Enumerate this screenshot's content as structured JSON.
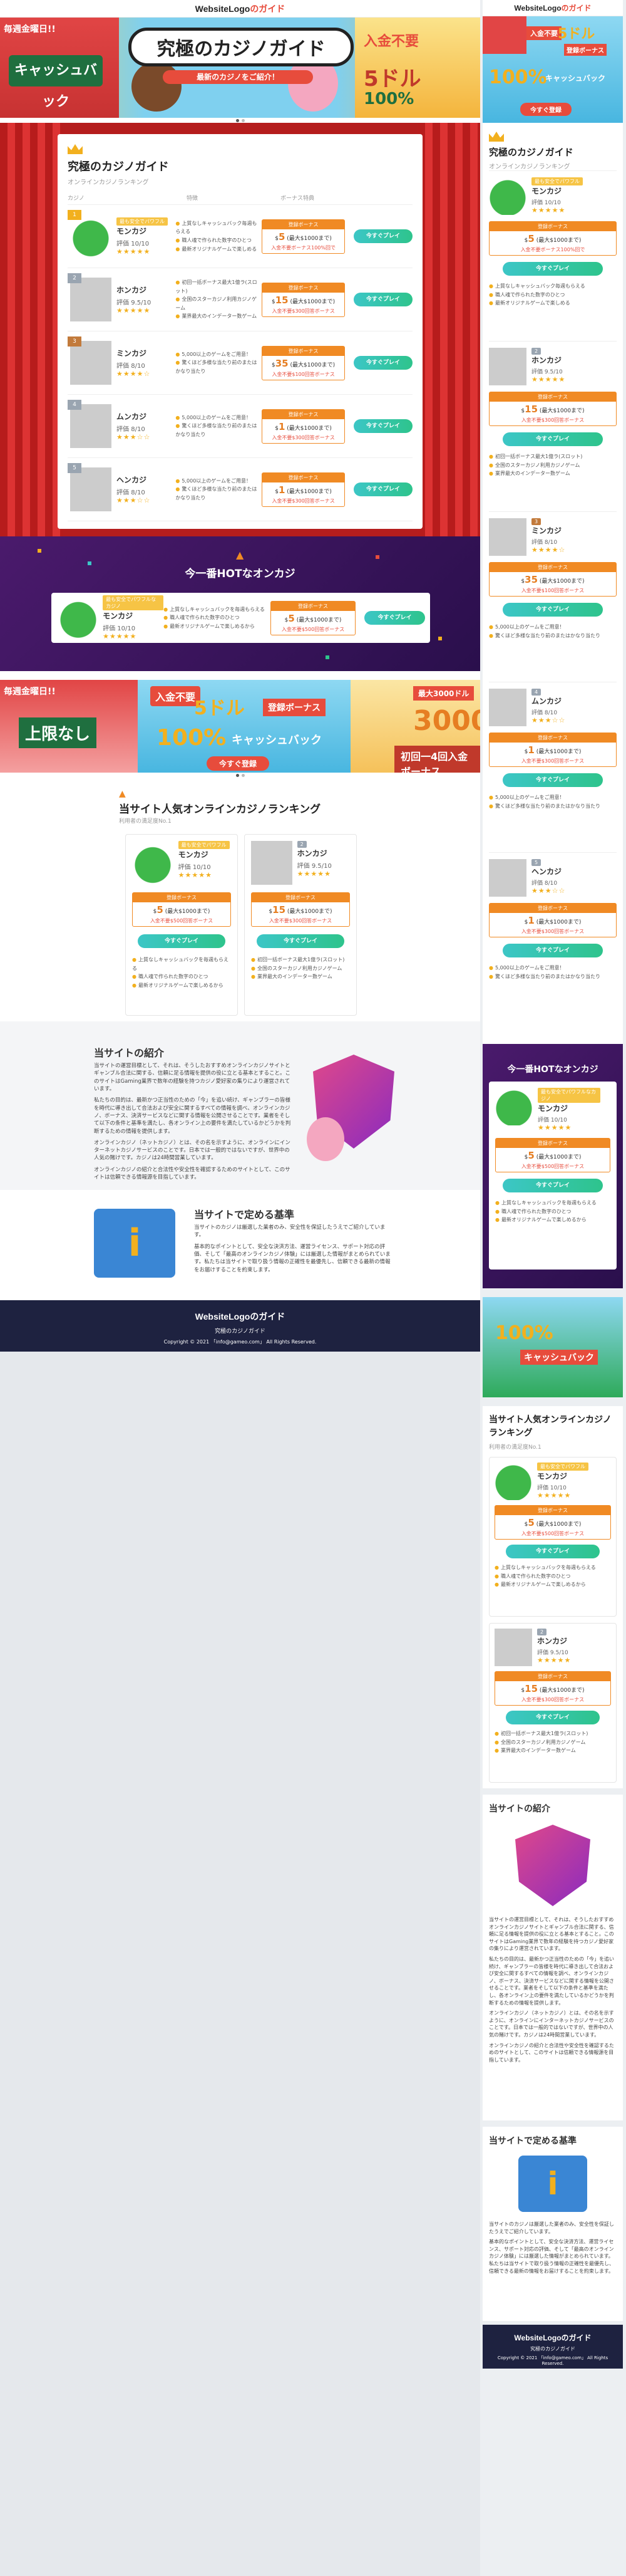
{
  "site": {
    "logo_main": "WebsiteLogo",
    "logo_accent": "のガイド"
  },
  "banner1": {
    "title": "究極のカジノガイド",
    "subtitle": "最新のカジノをご紹介！",
    "left_top": "毎週金曜日!!",
    "left_mid": "キャッシュバック",
    "right_top": "入金不要",
    "right_mid": "5ドル",
    "right_bottom": "100%"
  },
  "ranking": {
    "title": "究極のカジノガイド",
    "subtitle": "オンラインカジノランキング",
    "col1": "カジノ",
    "col2": "特徴",
    "col3": "ボーナス特典",
    "play": "今すぐプレイ",
    "rows": [
      {
        "rank": "1",
        "tag": "最も安全でパワフル",
        "name": "モンカジ",
        "score_label": "評価",
        "score": "10/10",
        "stars": "★★★★★",
        "f1": "上質なしキャッシュバック毎週もらえる",
        "f2": "職人魂で作られた数字のひとつ",
        "f3": "最新オリジナルゲームで楽しめる",
        "bonus_head": "登録ボーナス",
        "bonus_val": "$",
        "bonus_num": "5",
        "bonus_unit": "(最大$1000まで)",
        "bonus_note": "入金不要ボーナス100%回で",
        "bonus_note2": "入金不要$500回答ボーナス"
      },
      {
        "rank": "2",
        "tag": "",
        "name": "ホンカジ",
        "score_label": "評価",
        "score": "9.5/10",
        "stars": "★★★★★",
        "f1": "初回一括ボーナス最大1億ラ(スロット)",
        "f2": "全国のスターカジノ利用カジノゲーム",
        "f3": "業界最大のインデーター数ゲーム",
        "bonus_head": "登録ボーナス",
        "bonus_val": "$",
        "bonus_num": "15",
        "bonus_unit": "(最大$1000まで)",
        "bonus_note": "入金不要$300回答ボーナス",
        "bonus_note2": ""
      },
      {
        "rank": "3",
        "tag": "",
        "name": "ミンカジ",
        "score_label": "評価",
        "score": "8/10",
        "stars": "★★★★☆",
        "f1": "5,000以上のゲームをご用意！",
        "f2": "驚くほど多様な当たり前のまたはかなり当たり",
        "f3": "",
        "bonus_head": "登録ボーナス",
        "bonus_val": "$",
        "bonus_num": "35",
        "bonus_unit": "(最大$1000まで)",
        "bonus_note": "入金不要$100回答ボーナス",
        "bonus_note2": ""
      },
      {
        "rank": "4",
        "tag": "",
        "name": "ムンカジ",
        "score_label": "評価",
        "score": "8/10",
        "stars": "★★★☆☆",
        "f1": "5,000以上のゲームをご用意！",
        "f2": "驚くほど多様な当たり前のまたはかなり当たり",
        "f3": "",
        "bonus_head": "登録ボーナス",
        "bonus_val": "$",
        "bonus_num": "1",
        "bonus_unit": "(最大$1000まで)",
        "bonus_note": "入金不要$300回答ボーナス",
        "bonus_note2": ""
      },
      {
        "rank": "5",
        "tag": "",
        "name": "ヘンカジ",
        "score_label": "評価",
        "score": "8/10",
        "stars": "★★★☆☆",
        "f1": "5,000以上のゲームをご用意！",
        "f2": "驚くほど多様な当たり前のまたはかなり当たり",
        "f3": "",
        "bonus_head": "登録ボーナス",
        "bonus_val": "$",
        "bonus_num": "1",
        "bonus_unit": "(最大$1000まで)",
        "bonus_note": "入金不要$300回答ボーナス",
        "bonus_note2": ""
      }
    ]
  },
  "hot": {
    "title": "今一番HOTなオンカジ",
    "tag": "最も安全でパワフルなカジノ",
    "name": "モンカジ",
    "score_label": "評価",
    "score": "10/10",
    "stars": "★★★★★",
    "f1": "上質なしキャッシュバックを毎週もらえる",
    "f2": "職人魂で作られた数字のひとつ",
    "f3": "最新オリジナルゲームで楽しめるから",
    "bonus_head": "登録ボーナス",
    "bonus_num": "5",
    "bonus_unit": "(最大$1000まで)",
    "bonus_note": "入金不要$500回答ボーナス",
    "play": "今すぐプレイ"
  },
  "banner2": {
    "left_top": "毎週金曜日!!",
    "left_mid": "上限なし",
    "mid_top": "入金不要",
    "mid_big": "5ドル",
    "mid_bonus": "登録ボーナス",
    "mid_pct": "100%",
    "mid_cb": "キャッシュバック",
    "mid_btn": "今すぐ登録",
    "right_top": "最大3000ドル",
    "right_big": "3000",
    "right_sub": "初回一4回入金ボーナス"
  },
  "rank2": {
    "title": "当サイト人気オンラインカジノランキング",
    "subtitle": "利用者の満足度No.1",
    "play": "今すぐプレイ",
    "cards": [
      {
        "rank": "1",
        "tag": "最も安全でパワフル",
        "name": "モンカジ",
        "score_label": "評価",
        "score": "10/10",
        "stars": "★★★★★",
        "bonus_head": "登録ボーナス",
        "bonus_num": "5",
        "bonus_unit": "(最大$1000まで)",
        "bonus_note": "入金不要$500回答ボーナス",
        "f1": "上質なしキャッシュバックを毎週もらえる",
        "f2": "職人魂で作られた数字のひとつ",
        "f3": "最新オリジナルゲームで楽しめるから"
      },
      {
        "rank": "2",
        "tag": "",
        "name": "ホンカジ",
        "score_label": "評価",
        "score": "9.5/10",
        "stars": "★★★★★",
        "bonus_head": "登録ボーナス",
        "bonus_num": "15",
        "bonus_unit": "(最大$1000まで)",
        "bonus_note": "入金不要$300回答ボーナス",
        "f1": "初回一括ボーナス最大1億ラ(スロット)",
        "f2": "全国のスターカジノ利用カジノゲーム",
        "f3": "業界最大のインデーター数ゲーム"
      }
    ]
  },
  "intro": {
    "title": "当サイトの紹介",
    "p1": "当サイトの運営目標として、それは、そうしたおすすめオンラインカジノサイトとギャンブル合法に関する、信頼に足る情報を提供の役に立とる基本とすること。このサイトはGaming業界で数年の経験を持つカジノ愛好家の集りにより運営されています。",
    "p2": "私たちの目的は、最新かつ正当性のための「今」を追い続け、ギャンブラーの皆様を時代に導き出して合法および安全に関するすべての情報を調べ、オンラインカジノ、ボーナス、決済サービスなどに関する情報を公開させることです。業者をそして以下の条件と基準を満たし、各オンライン上の要件を満たしているかどうかを判断するための情報を提供します。",
    "p3": "オンラインカジノ（ネットカジノ）とは、その名を示すように、オンラインにインターネットカジノサービスのことです。日本では一般的ではないですが、世界中の人気の賭けです。カジノは24時間営業しています。",
    "p4": "オンラインカジノの紹介と合法性や安全性を確認するためのサイトとして、このサイトは信頼できる情報源を目指しています。"
  },
  "standard": {
    "title": "当サイトで定める基準",
    "p1": "当サイトのカジノは厳選した業者のみ、安全性を保証したうえでご紹介しています。",
    "p2": "基本的なポイントとして、安全な決済方法、運営ライセンス、サポート対応の評価、そして「最高のオンラインカジノ体験」には厳選した情報がまとめられています。私たちは当サイトで取り扱う情報の正確性を最優先し、信頼できる最新の情報をお届けすることを約束します。"
  },
  "footer": {
    "sub": "究極のカジノガイド",
    "copy": "Copyright © 2021 「info@gameo.com」 All Rights Reserved."
  },
  "right_extra": {
    "hot_title": "今一番HOTなオンカジ",
    "rank2_title": "当サイト人気オンラインカジノランキング",
    "intro_title": "当サイトの紹介",
    "std_title": "当サイトで定める基準"
  }
}
